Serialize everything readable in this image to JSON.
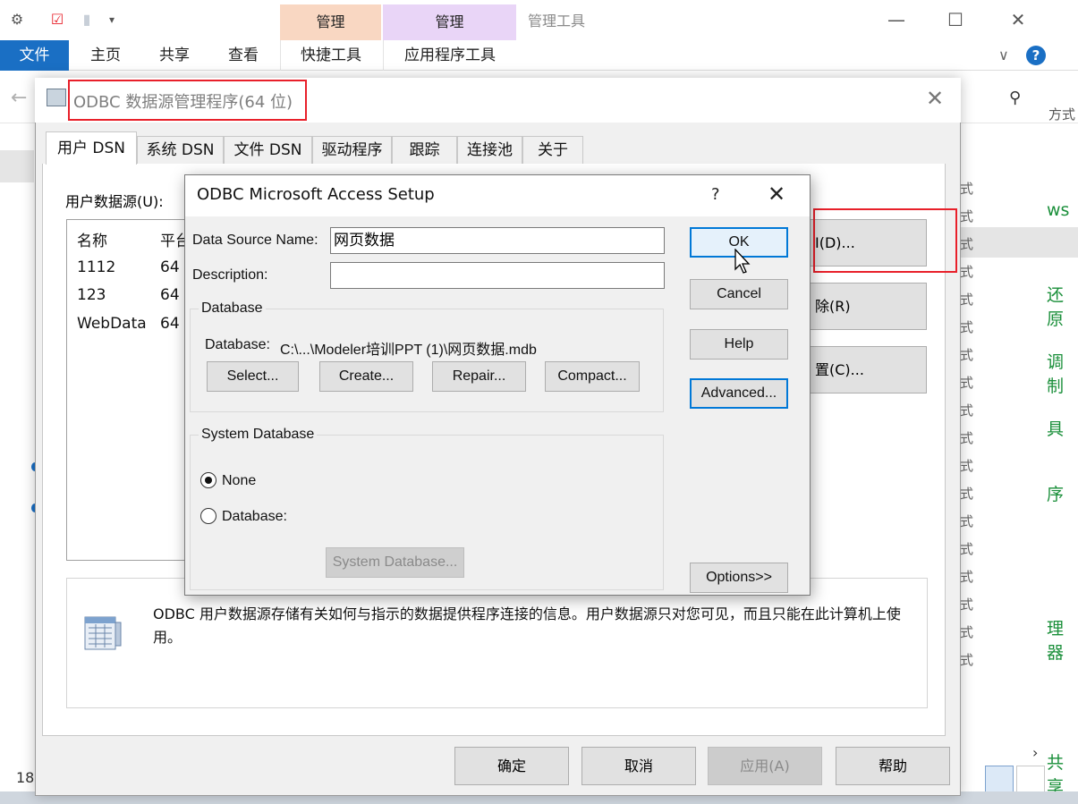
{
  "explorer": {
    "ribbon_context_labels": [
      "管理",
      "管理"
    ],
    "window_title": "管理工具",
    "tabs": [
      "文件",
      "主页",
      "共享",
      "查看"
    ],
    "context_tabs": [
      "快捷工具",
      "应用程序工具"
    ],
    "help": "?",
    "right_column_fragments": [
      "式",
      "式",
      "式",
      "式",
      "式",
      "式",
      "式",
      "式",
      "式",
      "式",
      "式",
      "式",
      "式",
      "式",
      "式",
      "式",
      "式",
      "式"
    ],
    "right_column_top": "方式",
    "green_items": [
      "ws",
      "还原",
      "调制",
      "具",
      "序",
      "理器",
      "共享"
    ],
    "status_count": "18",
    "colors": {
      "file_tab": "#1a6fc4",
      "context_manage_1": "#f9d7c2",
      "context_manage_2": "#e9d5f7",
      "green_text": "#1a8f3a",
      "highlight": "#e8202a"
    }
  },
  "odbc": {
    "title": "ODBC 数据源管理程序(64 位)",
    "tabs": [
      "用户 DSN",
      "系统 DSN",
      "文件 DSN",
      "驱动程序",
      "跟踪",
      "连接池",
      "关于"
    ],
    "active_tab": "用户 DSN",
    "user_data_sources_label": "用户数据源(U):",
    "columns": [
      "名称",
      "平台"
    ],
    "rows": [
      {
        "name": "1112",
        "platform": "64"
      },
      {
        "name": "123",
        "platform": "64"
      },
      {
        "name": "WebData",
        "platform": "64"
      }
    ],
    "side_buttons": [
      "I(D)...",
      "除(R)",
      "置(C)..."
    ],
    "info_text": "ODBC 用户数据源存储有关如何与指示的数据提供程序连接的信息。用户数据源只对您可见，而且只能在此计算机上使用。",
    "bottom_buttons": {
      "ok": "确定",
      "cancel": "取消",
      "apply": "应用(A)",
      "help": "帮助"
    }
  },
  "access": {
    "title": "ODBC Microsoft Access Setup",
    "help_glyph": "?",
    "close_glyph": "✕",
    "dsn_label": "Data Source Name:",
    "dsn_value": "网页数据",
    "description_label": "Description:",
    "description_value": "",
    "database_group": "Database",
    "database_path_label": "Database:",
    "database_path": "C:\\...\\Modeler培训PPT (1)\\网页数据.mdb",
    "db_buttons": [
      "Select...",
      "Create...",
      "Repair...",
      "Compact..."
    ],
    "system_db_group": "System Database",
    "radio_none": "None",
    "radio_database": "Database:",
    "system_db_button": "System Database...",
    "right_buttons": {
      "ok": "OK",
      "cancel": "Cancel",
      "help": "Help",
      "advanced": "Advanced...",
      "options": "Options>>"
    }
  }
}
